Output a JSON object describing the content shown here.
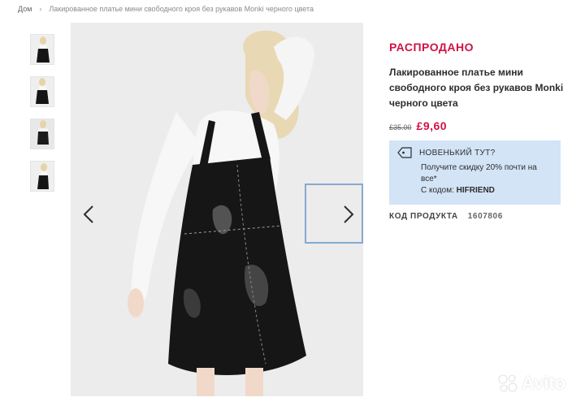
{
  "breadcrumb": {
    "home": "Дом",
    "separator": "›",
    "current": "Лакированное платье мини свободного кроя без рукавов Monki черного цвета"
  },
  "gallery": {
    "thumbnails": [
      {
        "label": "thumb-1"
      },
      {
        "label": "thumb-2"
      },
      {
        "label": "thumb-3"
      },
      {
        "label": "thumb-4"
      }
    ],
    "prev_icon": "chevron-left-icon",
    "next_icon": "chevron-right-icon"
  },
  "product": {
    "status": "РАСПРОДАНО",
    "title": "Лакированное платье мини свободного кроя без рукавов Monki черного цвета",
    "old_price": "£35.00",
    "new_price": "£9,60",
    "code_label": "КОД ПРОДУКТА",
    "code_value": "1607806"
  },
  "promo": {
    "icon": "tag-icon",
    "heading": "НОВЕНЬКИЙ ТУТ?",
    "text": "Получите скидку 20% почти на все*",
    "code_prefix": "С кодом:",
    "code": "HIFRIEND"
  },
  "watermark": {
    "text": "Avito"
  },
  "colors": {
    "accent": "#d01345",
    "promo_bg": "#d2e4f6",
    "focus": "#86a9d1"
  }
}
